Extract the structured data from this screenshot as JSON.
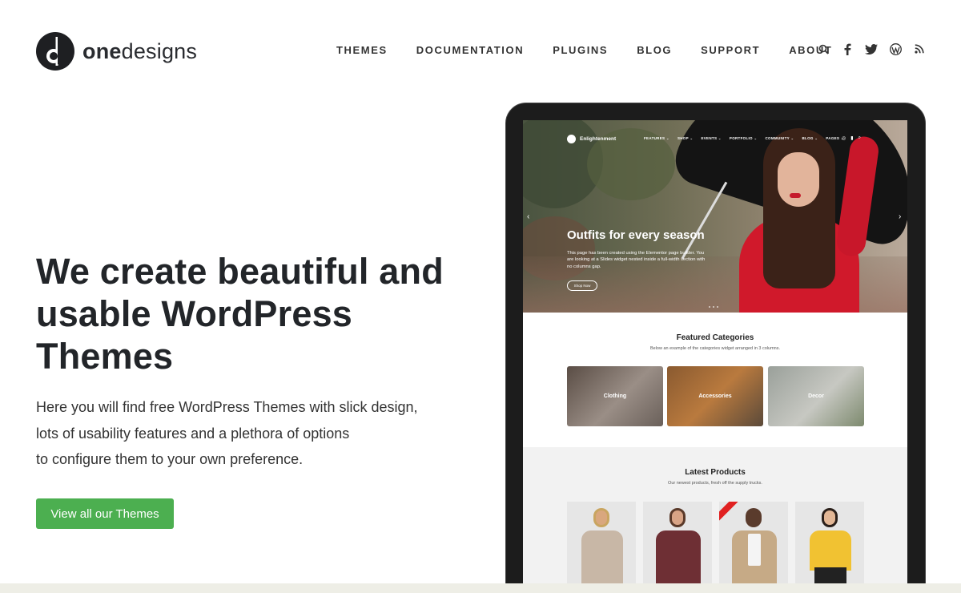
{
  "brand": {
    "name_bold": "one",
    "name_regular": "designs"
  },
  "nav": {
    "items": [
      "THEMES",
      "DOCUMENTATION",
      "PLUGINS",
      "BLOG",
      "SUPPORT",
      "ABOUT"
    ]
  },
  "social": {
    "icons": [
      "search-icon",
      "facebook-icon",
      "twitter-icon",
      "wordpress-icon",
      "rss-icon"
    ]
  },
  "hero": {
    "title": "We create beautiful and usable WordPress Themes",
    "description_lines": [
      "Here you will find free WordPress Themes with slick design,",
      "lots of usability features and a plethora of options",
      "to configure them to your own preference."
    ],
    "cta_label": "View all our Themes"
  },
  "preview": {
    "site_name": "Enlightenment",
    "menu": [
      "FEATURES ⌄",
      "SHOP ⌄",
      "EVENTS ⌄",
      "PORTFOLIO ⌄",
      "COMMUNITY ⌄",
      "BLOG ⌄",
      "PAGES ⌄"
    ],
    "slide": {
      "title": "Outfits for every season",
      "text": "This page has been created using the Elementor page builder. You are looking at a Slides widget nested inside a full-width section with no columns gap.",
      "button": "Shop Now"
    },
    "featured": {
      "title": "Featured Categories",
      "subtitle": "Below an example of the categories widget arranged in 3 columns.",
      "categories": [
        "Clothing",
        "Accessories",
        "Decor"
      ]
    },
    "latest": {
      "title": "Latest Products",
      "subtitle": "Our newest products, fresh off the supply trucks."
    }
  },
  "colors": {
    "accent": "#4caf50",
    "text": "#222529",
    "band": "#eeeee6"
  }
}
